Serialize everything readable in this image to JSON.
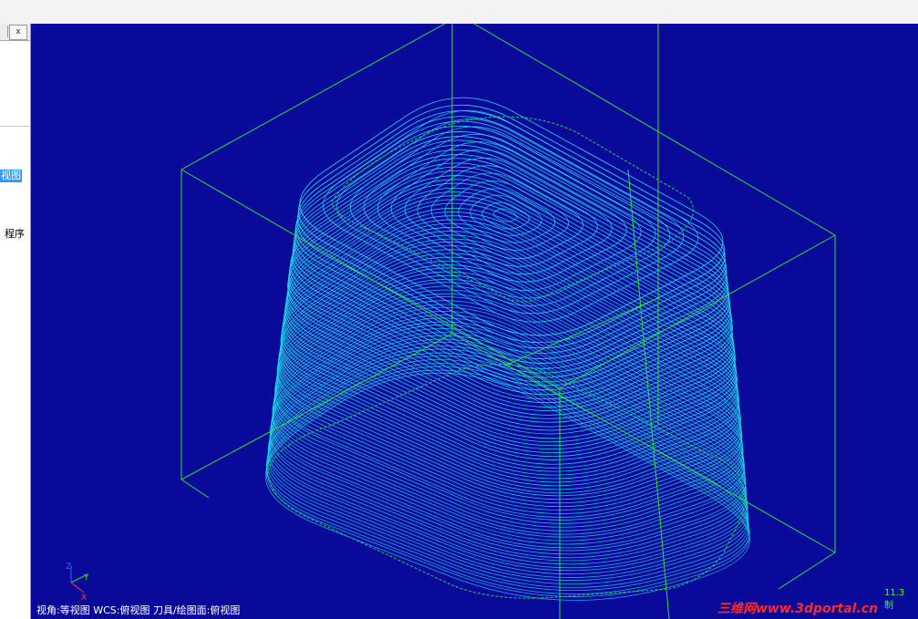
{
  "panel": {
    "close_label": "x",
    "tree_item_view": "视图",
    "tree_item_program": "程序"
  },
  "viewport": {
    "status_text": "视角:等视图   WCS:俯视图   刀具/绘图面:俯视图",
    "right_readout": "11.3",
    "right_readout_2": "制",
    "watermark": "三维网www.3dportal.cn",
    "axis_labels": {
      "x": "X",
      "y": "Y",
      "z": "Z"
    }
  },
  "colors": {
    "viewport_bg": "#0a0a9a",
    "toolpath": "#22ddee",
    "bounding_box": "#33dd33",
    "status_text": "#ffffff",
    "readout": "#33ff33",
    "watermark": "#ff2a2a"
  },
  "icons": [
    "pin-icon",
    "close-icon",
    "axis-triad-icon"
  ]
}
